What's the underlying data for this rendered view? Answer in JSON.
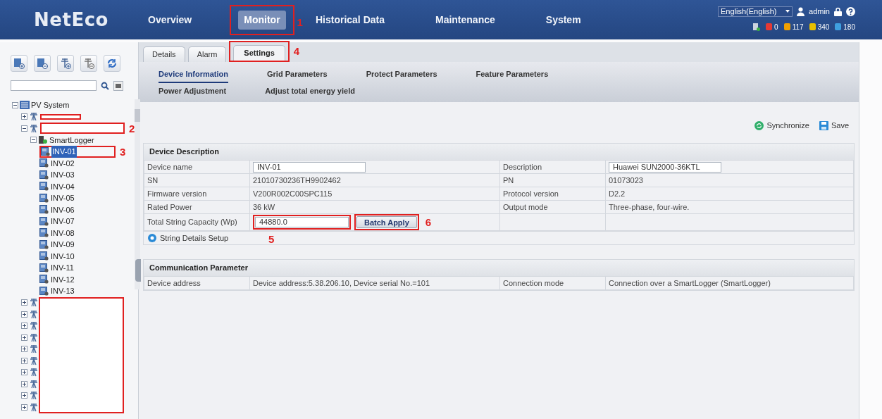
{
  "header": {
    "logo": "NetEco",
    "nav": [
      {
        "label": "Overview",
        "selected": false
      },
      {
        "label": "Monitor",
        "selected": true,
        "callout": "1"
      },
      {
        "label": "Historical Data",
        "selected": false
      },
      {
        "label": "Maintenance",
        "selected": false
      },
      {
        "label": "System",
        "selected": false
      }
    ],
    "language": "English(English)",
    "user": "admin",
    "alarms": [
      {
        "count": "0",
        "color": "#e53935"
      },
      {
        "count": "117",
        "color": "#f0a000"
      },
      {
        "count": "340",
        "color": "#e8c000"
      },
      {
        "count": "180",
        "color": "#3fa0e0"
      }
    ]
  },
  "tree": {
    "root": {
      "label": "PV System",
      "expanded": true,
      "children": [
        {
          "kind": "station",
          "expanded": false,
          "redacted": true
        },
        {
          "kind": "station",
          "expanded": true,
          "redacted": true,
          "callout": "2",
          "children": [
            {
              "kind": "logger",
              "label": "SmartLogger",
              "expanded": true,
              "children": [
                {
                  "kind": "inverter",
                  "label": "INV-01",
                  "selected": true,
                  "callout": "3"
                },
                {
                  "kind": "inverter",
                  "label": "INV-02",
                  "selected": false
                },
                {
                  "kind": "inverter",
                  "label": "INV-03",
                  "selected": false
                },
                {
                  "kind": "inverter",
                  "label": "INV-04",
                  "selected": false
                },
                {
                  "kind": "inverter",
                  "label": "INV-05",
                  "selected": false
                },
                {
                  "kind": "inverter",
                  "label": "INV-06",
                  "selected": false
                },
                {
                  "kind": "inverter",
                  "label": "INV-07",
                  "selected": false
                },
                {
                  "kind": "inverter",
                  "label": "INV-08",
                  "selected": false
                },
                {
                  "kind": "inverter",
                  "label": "INV-09",
                  "selected": false
                },
                {
                  "kind": "inverter",
                  "label": "INV-10",
                  "selected": false
                },
                {
                  "kind": "inverter",
                  "label": "INV-11",
                  "selected": false
                },
                {
                  "kind": "inverter",
                  "label": "INV-12",
                  "selected": false
                },
                {
                  "kind": "inverter",
                  "label": "INV-13",
                  "selected": false
                }
              ]
            }
          ]
        }
      ]
    },
    "collapsed_stations": [
      {
        "expanded": false
      },
      {
        "expanded": false
      },
      {
        "expanded": false
      },
      {
        "expanded": false
      },
      {
        "expanded": false
      },
      {
        "expanded": false
      },
      {
        "expanded": false
      },
      {
        "expanded": false
      },
      {
        "expanded": false
      },
      {
        "expanded": false
      }
    ]
  },
  "tabs": [
    {
      "label": "Details",
      "selected": false
    },
    {
      "label": "Alarm",
      "selected": false
    },
    {
      "label": "Settings",
      "selected": true,
      "callout": "4"
    }
  ],
  "subtabs": [
    {
      "label": "Device Information",
      "selected": true
    },
    {
      "label": "Grid Parameters",
      "selected": false
    },
    {
      "label": "Protect Parameters",
      "selected": false
    },
    {
      "label": "Feature Parameters",
      "selected": false
    },
    {
      "label": "Power Adjustment",
      "selected": false
    },
    {
      "label": "Adjust total energy yield",
      "selected": false
    }
  ],
  "actions": [
    {
      "kind": "sync",
      "label": "Synchronize"
    },
    {
      "kind": "save",
      "label": "Save"
    }
  ],
  "sections": [
    {
      "title": "Device Description",
      "rows": [
        [
          {
            "kind": "label",
            "text": "Device name"
          },
          {
            "kind": "input",
            "text": "INV-01"
          },
          {
            "kind": "label",
            "text": "Description"
          },
          {
            "kind": "input",
            "text": "Huawei SUN2000-36KTL"
          }
        ],
        [
          {
            "kind": "label",
            "text": "SN"
          },
          {
            "kind": "text",
            "text": "21010730236TH9902462"
          },
          {
            "kind": "label",
            "text": "PN"
          },
          {
            "kind": "text",
            "text": "01073023"
          }
        ],
        [
          {
            "kind": "label",
            "text": "Firmware version"
          },
          {
            "kind": "text",
            "text": "V200R002C00SPC115"
          },
          {
            "kind": "label",
            "text": "Protocol version"
          },
          {
            "kind": "text",
            "text": "D2.2"
          }
        ],
        [
          {
            "kind": "label",
            "text": "Rated Power"
          },
          {
            "kind": "text",
            "text": "36 kW"
          },
          {
            "kind": "label",
            "text": "Output mode"
          },
          {
            "kind": "text",
            "text": "Three-phase, four-wire."
          }
        ],
        [
          {
            "kind": "label",
            "text": "Total String Capacity (Wp)"
          },
          {
            "kind": "input_button",
            "text": "44880.0",
            "callout": "5",
            "button": "Batch Apply",
            "button_callout": "6"
          },
          {
            "kind": "empty"
          },
          {
            "kind": "empty"
          }
        ]
      ],
      "link": "String Details Setup"
    },
    {
      "title": "Communication Parameter",
      "rows": [
        [
          {
            "kind": "label",
            "text": "Device address"
          },
          {
            "kind": "text",
            "text": "Device address:5.38.206.10, Device serial No.=101"
          },
          {
            "kind": "label",
            "text": "Connection mode"
          },
          {
            "kind": "text",
            "text": "Connection over a SmartLogger (SmartLogger)"
          }
        ]
      ]
    }
  ]
}
